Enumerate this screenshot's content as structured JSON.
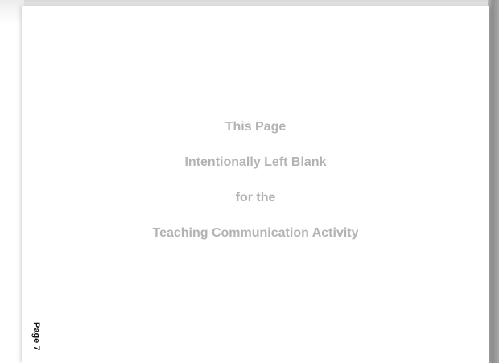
{
  "document": {
    "lines": [
      "This Page",
      "Intentionally Left Blank",
      "for the",
      "Teaching Communication Activity"
    ],
    "page_label": "Page 7"
  },
  "colors": {
    "faint_text": "#b3b3b3",
    "page_label_text": "#111111",
    "page_background": "#ffffff"
  }
}
